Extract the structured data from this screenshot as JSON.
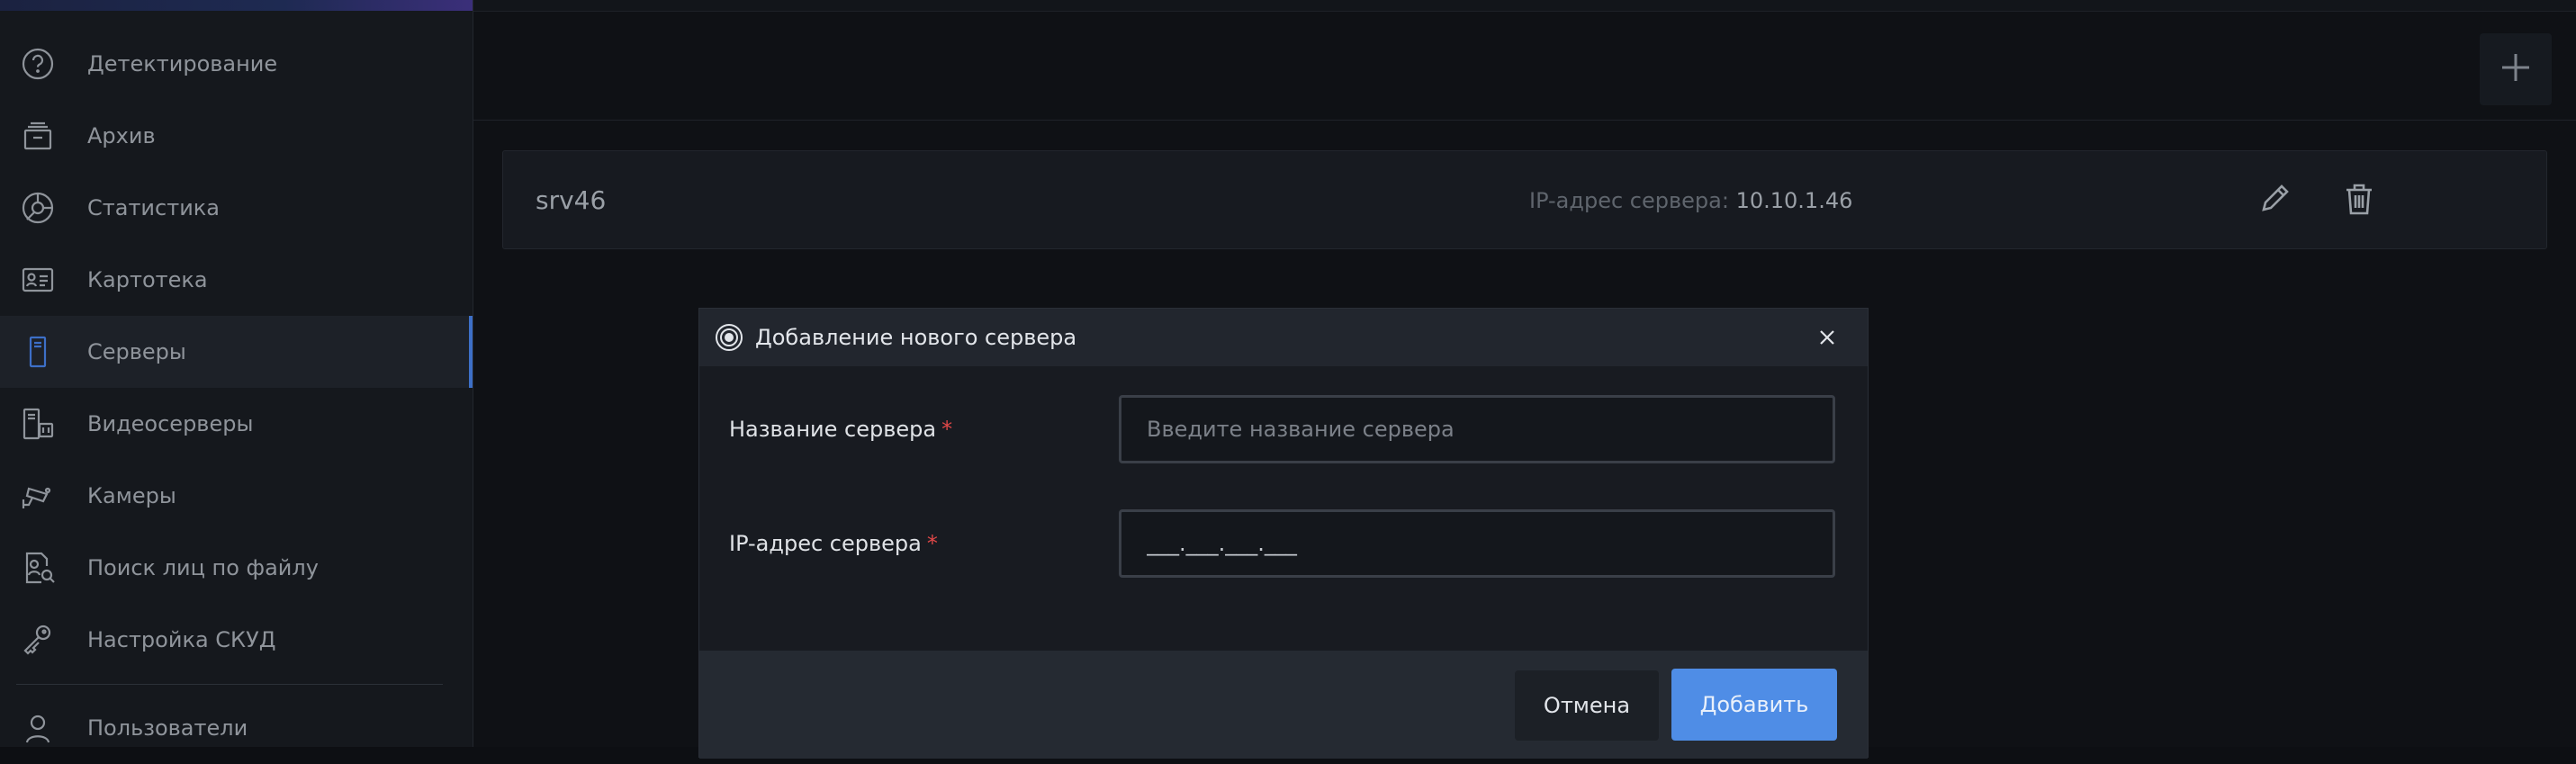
{
  "sidebar": {
    "items": [
      {
        "label": "Детектирование",
        "icon": "help-circle-icon"
      },
      {
        "label": "Архив",
        "icon": "archive-icon"
      },
      {
        "label": "Статистика",
        "icon": "statistics-icon"
      },
      {
        "label": "Картотека",
        "icon": "card-index-icon"
      },
      {
        "label": "Серверы",
        "icon": "server-icon",
        "active": true
      },
      {
        "label": "Видеосерверы",
        "icon": "video-server-icon"
      },
      {
        "label": "Камеры",
        "icon": "camera-icon"
      },
      {
        "label": "Поиск лиц по файлу",
        "icon": "face-search-icon"
      },
      {
        "label": "Настройка СКУД",
        "icon": "keys-icon"
      },
      {
        "label": "Пользователи",
        "icon": "user-icon"
      }
    ]
  },
  "server_card": {
    "name": "srv46",
    "ip_label": "IP-адрес сервера:",
    "ip_value": "10.10.1.46"
  },
  "modal": {
    "title": "Добавление нового сервера",
    "name_label": "Название сервера",
    "name_placeholder": "Введите название сервера",
    "ip_label": "IP-адрес сервера",
    "ip_value": "___.___.___.___",
    "required_mark": "*",
    "cancel_label": "Отмена",
    "add_label": "Добавить"
  },
  "colors": {
    "accent": "#4f8de6",
    "active_indicator": "#3d6fc7",
    "required": "#e04848"
  }
}
